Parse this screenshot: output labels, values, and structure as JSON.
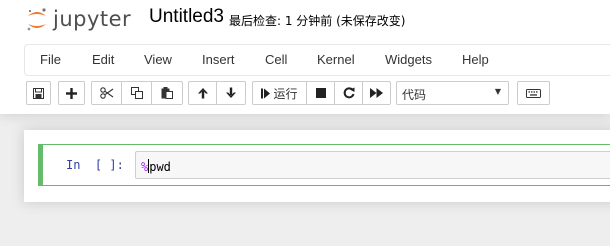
{
  "app": {
    "logo_text": "jupyter",
    "notebook_title": "Untitled3",
    "save_status": "最后检查: 1 分钟前  (未保存改变)"
  },
  "menubar": {
    "items": [
      "File",
      "Edit",
      "View",
      "Insert",
      "Cell",
      "Kernel",
      "Widgets",
      "Help"
    ]
  },
  "toolbar": {
    "run_label": "运行",
    "cell_type": "代码",
    "icons": [
      "save-icon",
      "plus-icon",
      "cut-icon",
      "copy-icon",
      "paste-icon",
      "arrow-up-icon",
      "arrow-down-icon",
      "step-forward-icon",
      "stop-icon",
      "refresh-icon",
      "fast-forward-icon",
      "keyboard-icon"
    ]
  },
  "cell": {
    "prompt": "In  [ ]:",
    "code_magic": "%",
    "code_rest": "pwd"
  },
  "colors": {
    "logo_orange": "#f37726",
    "cell_border_green": "#66bb6a",
    "prompt_blue": "#303f9f",
    "magic_purple": "#aa22ff"
  }
}
